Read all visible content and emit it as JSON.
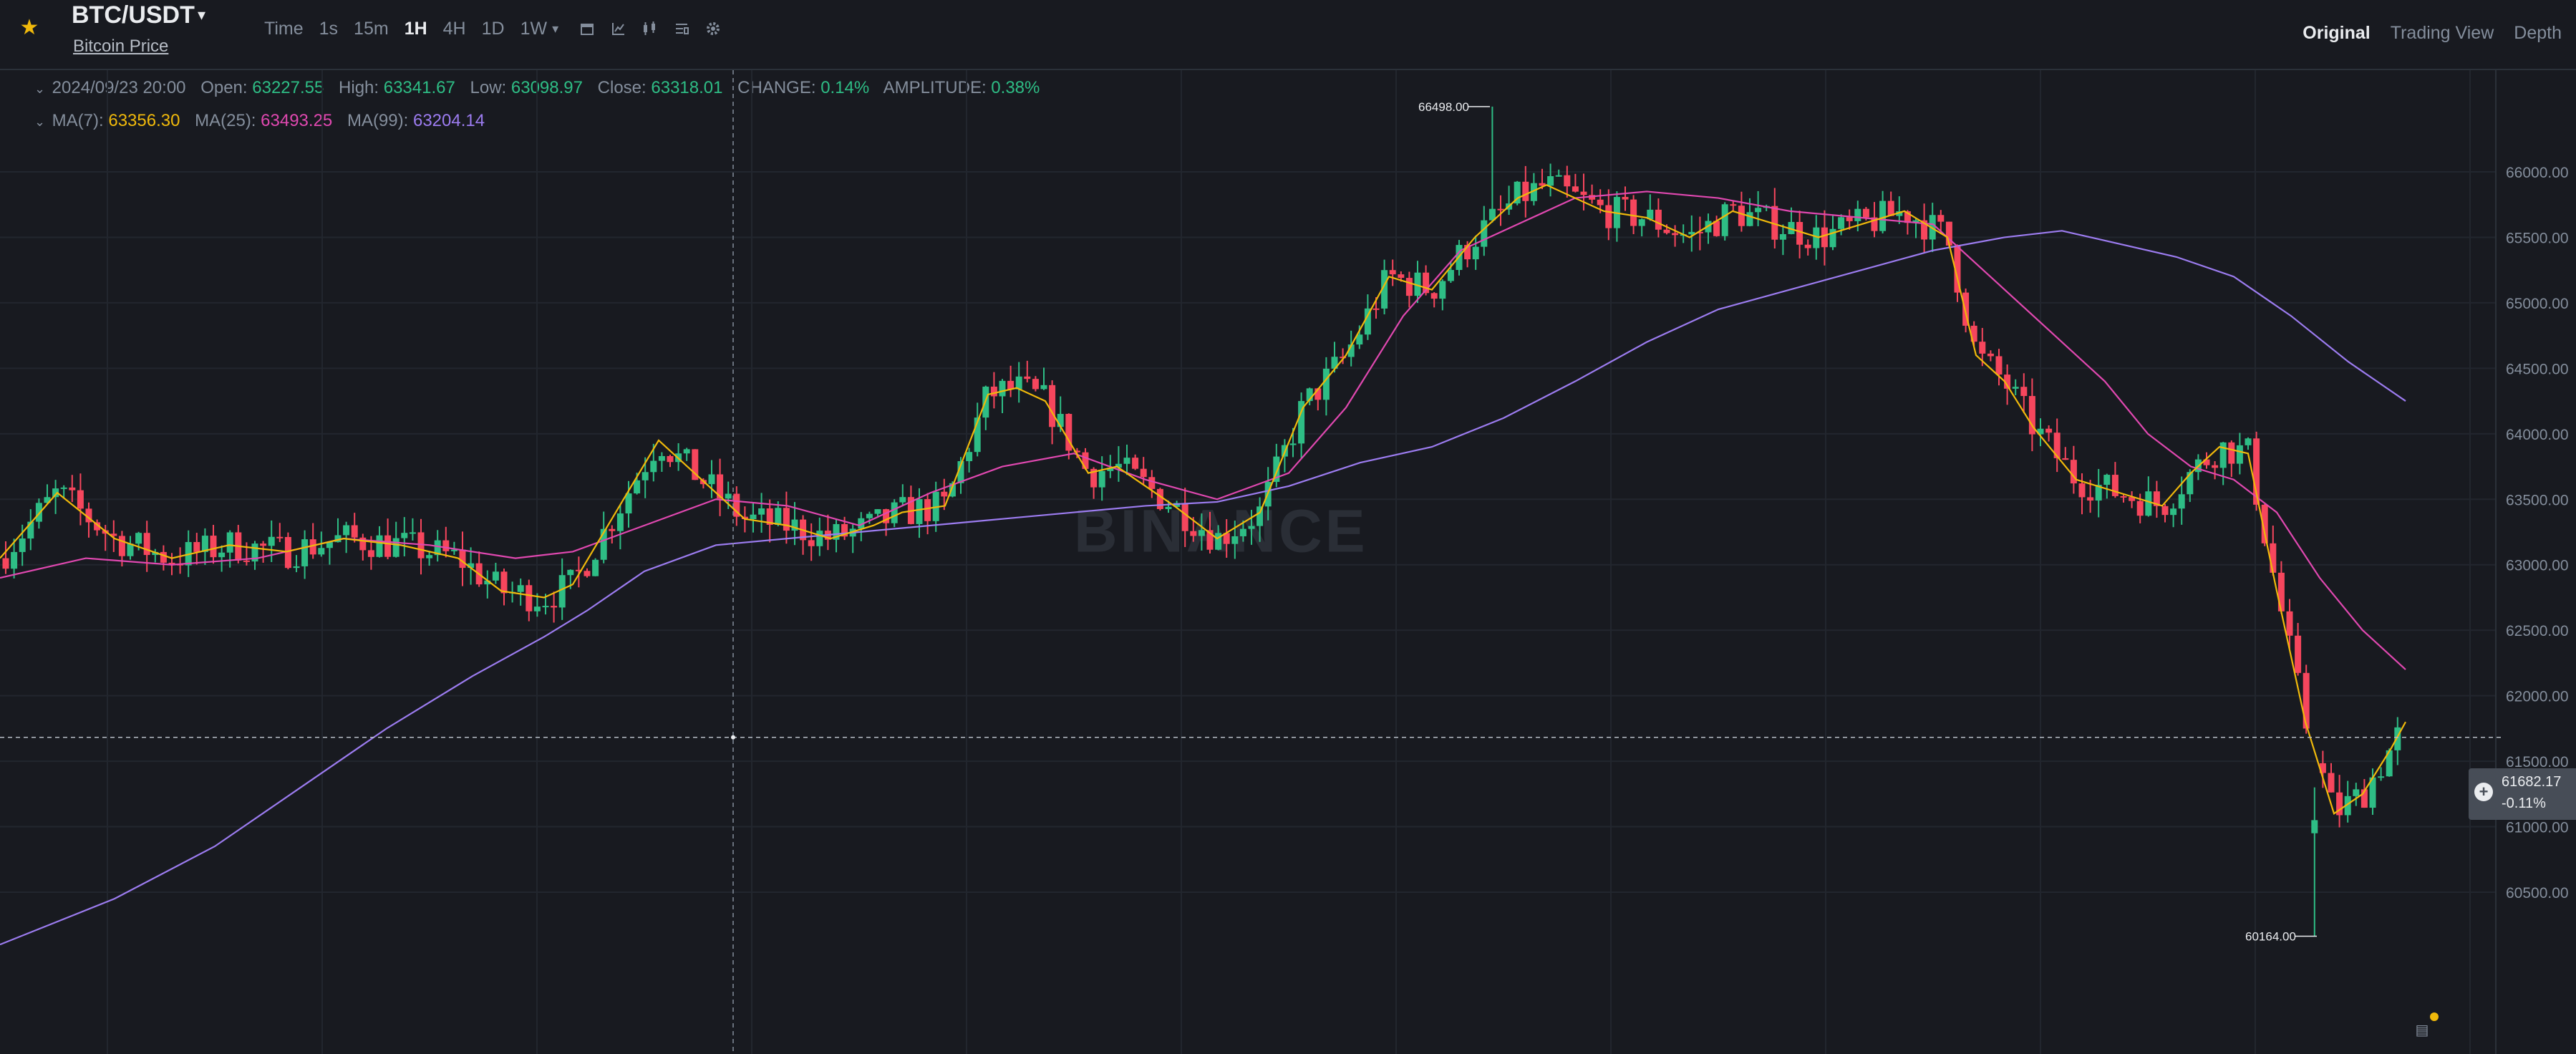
{
  "header": {
    "pair": "BTC/USDT",
    "subtitle": "Bitcoin Price",
    "intervals": [
      "Time",
      "1s",
      "15m",
      "1H",
      "4H",
      "1D",
      "1W"
    ],
    "active_interval": "1H",
    "views": [
      "Original",
      "Trading View",
      "Depth"
    ],
    "active_view": "Original"
  },
  "ohlc": {
    "date": "2024/09/23 20:00",
    "open_label": "Open:",
    "open": "63227.55",
    "high_label": "High:",
    "high": "63341.67",
    "low_label": "Low:",
    "low": "63098.97",
    "close_label": "Close:",
    "close": "63318.01",
    "change_label": "CHANGE:",
    "change": "0.14%",
    "amplitude_label": "AMPLITUDE:",
    "amplitude": "0.38%"
  },
  "ma": {
    "ma7_label": "MA(7):",
    "ma7": "63356.30",
    "ma25_label": "MA(25):",
    "ma25": "63493.25",
    "ma99_label": "MA(99):",
    "ma99": "63204.14"
  },
  "price_tag": {
    "price": "61682.17",
    "change": "-0.11%"
  },
  "colors": {
    "up": "#2ebd85",
    "down": "#f6465d",
    "ma7": "#f0b90b",
    "ma25": "#e048b0",
    "ma99": "#9c7cf0",
    "background": "#181a20"
  },
  "chart_data": {
    "type": "candlestick",
    "y_ticks": [
      "60500.00",
      "61000.00",
      "61500.00",
      "62000.00",
      "62500.00",
      "63000.00",
      "63500.00",
      "64000.00",
      "64500.00",
      "65000.00",
      "65500.00",
      "66000.00"
    ],
    "ylim": [
      60050,
      66750
    ],
    "high_marker": "66498.00",
    "low_marker": "60164.00",
    "watermark": "BINANCE",
    "ma7_points": [
      [
        0,
        63050
      ],
      [
        80,
        63550
      ],
      [
        160,
        63200
      ],
      [
        240,
        63050
      ],
      [
        320,
        63150
      ],
      [
        400,
        63100
      ],
      [
        480,
        63200
      ],
      [
        560,
        63150
      ],
      [
        640,
        63050
      ],
      [
        700,
        62800
      ],
      [
        760,
        62750
      ],
      [
        800,
        62850
      ],
      [
        860,
        63400
      ],
      [
        920,
        63950
      ],
      [
        980,
        63650
      ],
      [
        1040,
        63350
      ],
      [
        1100,
        63300
      ],
      [
        1160,
        63200
      ],
      [
        1220,
        63300
      ],
      [
        1260,
        63400
      ],
      [
        1320,
        63450
      ],
      [
        1380,
        64300
      ],
      [
        1420,
        64350
      ],
      [
        1460,
        64250
      ],
      [
        1520,
        63700
      ],
      [
        1560,
        63750
      ],
      [
        1640,
        63450
      ],
      [
        1700,
        63200
      ],
      [
        1760,
        63400
      ],
      [
        1820,
        64200
      ],
      [
        1880,
        64600
      ],
      [
        1940,
        65200
      ],
      [
        2000,
        65100
      ],
      [
        2060,
        65500
      ],
      [
        2120,
        65800
      ],
      [
        2160,
        65900
      ],
      [
        2200,
        65800
      ],
      [
        2240,
        65700
      ],
      [
        2300,
        65650
      ],
      [
        2360,
        65500
      ],
      [
        2420,
        65700
      ],
      [
        2480,
        65600
      ],
      [
        2540,
        65500
      ],
      [
        2600,
        65600
      ],
      [
        2660,
        65700
      ],
      [
        2720,
        65500
      ],
      [
        2760,
        64600
      ],
      [
        2800,
        64400
      ],
      [
        2840,
        64050
      ],
      [
        2900,
        63650
      ],
      [
        2960,
        63550
      ],
      [
        3020,
        63450
      ],
      [
        3060,
        63700
      ],
      [
        3100,
        63900
      ],
      [
        3140,
        63850
      ],
      [
        3180,
        62800
      ],
      [
        3220,
        61800
      ],
      [
        3260,
        61100
      ],
      [
        3300,
        61250
      ],
      [
        3340,
        61600
      ],
      [
        3360,
        61800
      ]
    ],
    "ma25_points": [
      [
        0,
        62900
      ],
      [
        120,
        63050
      ],
      [
        240,
        63000
      ],
      [
        360,
        63050
      ],
      [
        480,
        63200
      ],
      [
        600,
        63150
      ],
      [
        720,
        63050
      ],
      [
        800,
        63100
      ],
      [
        900,
        63300
      ],
      [
        1000,
        63500
      ],
      [
        1100,
        63450
      ],
      [
        1200,
        63300
      ],
      [
        1300,
        63550
      ],
      [
        1400,
        63750
      ],
      [
        1500,
        63850
      ],
      [
        1600,
        63650
      ],
      [
        1700,
        63500
      ],
      [
        1800,
        63700
      ],
      [
        1880,
        64200
      ],
      [
        1960,
        64900
      ],
      [
        2040,
        65400
      ],
      [
        2120,
        65600
      ],
      [
        2200,
        65800
      ],
      [
        2300,
        65850
      ],
      [
        2400,
        65800
      ],
      [
        2500,
        65700
      ],
      [
        2600,
        65650
      ],
      [
        2700,
        65600
      ],
      [
        2780,
        65200
      ],
      [
        2860,
        64800
      ],
      [
        2940,
        64400
      ],
      [
        3000,
        64000
      ],
      [
        3060,
        63750
      ],
      [
        3120,
        63650
      ],
      [
        3180,
        63400
      ],
      [
        3240,
        62900
      ],
      [
        3300,
        62500
      ],
      [
        3360,
        62200
      ]
    ],
    "ma99_points": [
      [
        0,
        60100
      ],
      [
        160,
        60450
      ],
      [
        300,
        60850
      ],
      [
        420,
        61300
      ],
      [
        540,
        61750
      ],
      [
        660,
        62150
      ],
      [
        760,
        62450
      ],
      [
        820,
        62650
      ],
      [
        900,
        62950
      ],
      [
        1000,
        63150
      ],
      [
        1100,
        63200
      ],
      [
        1200,
        63250
      ],
      [
        1300,
        63300
      ],
      [
        1400,
        63350
      ],
      [
        1500,
        63400
      ],
      [
        1600,
        63450
      ],
      [
        1700,
        63480
      ],
      [
        1800,
        63600
      ],
      [
        1900,
        63780
      ],
      [
        2000,
        63900
      ],
      [
        2100,
        64120
      ],
      [
        2200,
        64400
      ],
      [
        2300,
        64700
      ],
      [
        2400,
        64950
      ],
      [
        2500,
        65100
      ],
      [
        2600,
        65250
      ],
      [
        2700,
        65400
      ],
      [
        2800,
        65500
      ],
      [
        2880,
        65550
      ],
      [
        2960,
        65450
      ],
      [
        3040,
        65350
      ],
      [
        3120,
        65200
      ],
      [
        3200,
        64900
      ],
      [
        3280,
        64550
      ],
      [
        3360,
        64250
      ]
    ]
  }
}
